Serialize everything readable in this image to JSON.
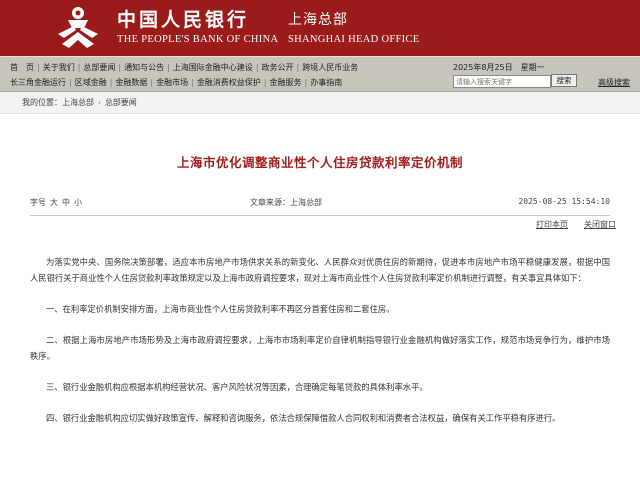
{
  "header": {
    "brand_cn": "中国人民银行",
    "branch_cn": "上海总部",
    "brand_en": "THE PEOPLE'S BANK OF CHINA",
    "branch_en": "SHANGHAI HEAD OFFICE",
    "logo_icon": "pboc-emblem-icon",
    "bg_color": "#9b1b1b"
  },
  "nav": {
    "row1": [
      "首　页",
      "关于我们",
      "总部要闻",
      "通知与公告",
      "上海国际金融中心建设",
      "政务公开",
      "跨境人民币业务"
    ],
    "row2": [
      "长三角金融运行",
      "区域金融",
      "金融数据",
      "金融市场",
      "金融消费权益保护",
      "金融服务",
      "办事指南"
    ],
    "date": "2025年8月25日　星期一",
    "search_placeholder": "请输入搜索关键字",
    "search_button": "搜索",
    "advanced_search": "高级搜索"
  },
  "breadcrumb": {
    "prefix": "我的位置：",
    "items": [
      "上海总部",
      "总部要闻"
    ]
  },
  "article": {
    "title": "上海市优化调整商业性个人住房贷款利率定价机制",
    "font_size_label": "字号",
    "font_sizes": [
      "大",
      "中",
      "小"
    ],
    "source": "文章来源：上海总部",
    "time": "2025-08-25  15:54:10",
    "print": "打印本页",
    "close": "关闭窗口",
    "title_color": "#a31d1d",
    "paragraphs": [
      "为落实党中央、国务院决策部署，适应本市房地产市场供求关系的新变化、人民群众对优质住房的新期待，促进本市房地产市场平稳健康发展，根据中国人民银行关于商业性个人住房贷款利率政策规定以及上海市政府调控要求，现对上海市商业性个人住房贷款利率定价机制进行调整，有关事宜具体如下：",
      "一、在利率定价机制安排方面，上海市商业性个人住房贷款利率不再区分首套住房和二套住房。",
      "二、根据上海市房地产市场形势及上海市政府调控要求，上海市市场利率定价自律机制指导银行业金融机构做好落实工作，规范市场竞争行为，维护市场秩序。",
      "三、银行业金融机构应根据本机构经营状况、客户风险状况等因素，合理确定每笔贷款的具体利率水平。",
      "四、银行业金融机构应切实做好政策宣传、解释和咨询服务，依法合规保障借款人合同权利和消费者合法权益，确保有关工作平稳有序进行。"
    ]
  }
}
